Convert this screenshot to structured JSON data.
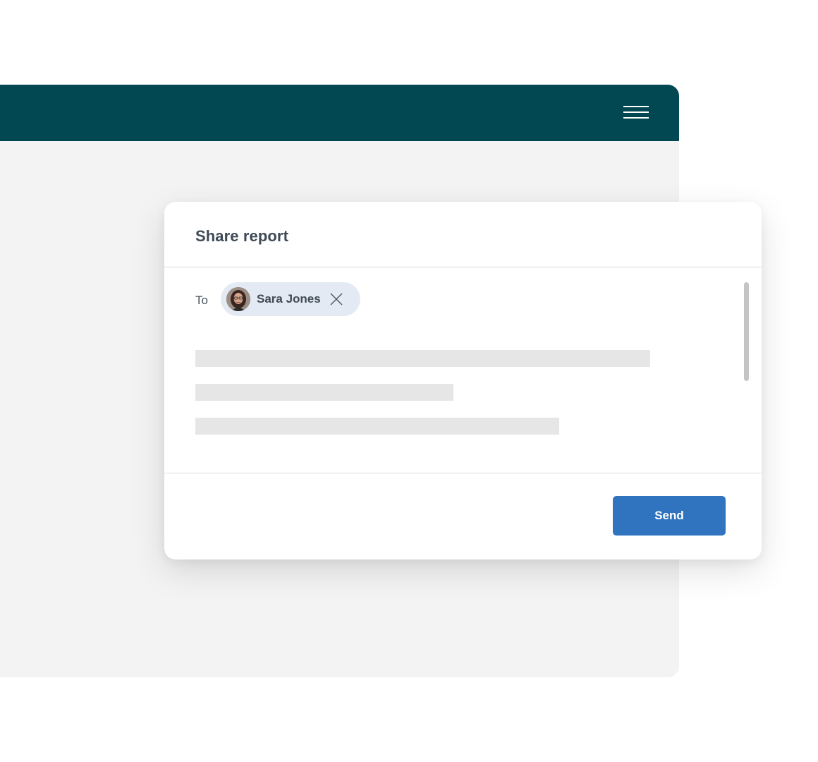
{
  "app": {
    "header_color": "#014852",
    "menu_icon": "hamburger-menu-icon"
  },
  "dialog": {
    "title": "Share report",
    "to_label": "To",
    "recipient": {
      "name": "Sara Jones",
      "avatar_icon": "user-avatar",
      "remove_icon": "close-icon"
    },
    "message_placeholder_lines": 3,
    "send_label": "Send",
    "accent_color": "#3074bf"
  }
}
